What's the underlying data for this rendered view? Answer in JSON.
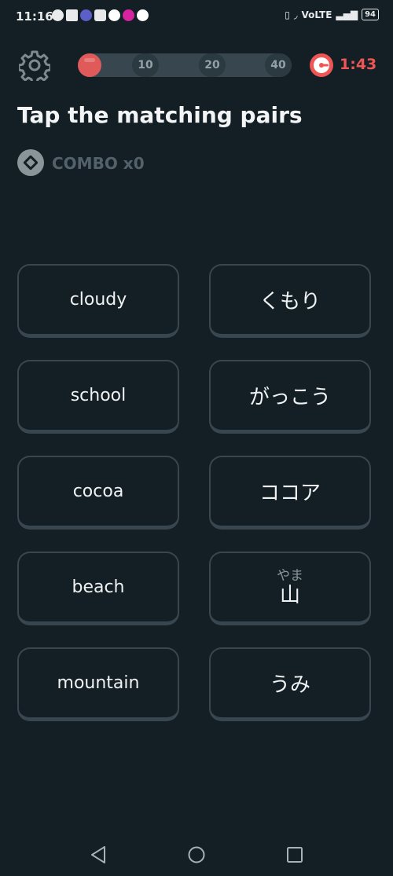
{
  "status": {
    "time": "11:16",
    "network": "VoLTE",
    "battery": "94"
  },
  "header": {
    "progress_fraction": 0.05,
    "milestones": [
      "10",
      "20",
      "40"
    ],
    "timer": "1:43"
  },
  "title": "Tap the matching pairs",
  "combo": "COMBO x0",
  "pairs": {
    "left": [
      "cloudy",
      "school",
      "cocoa",
      "beach",
      "mountain"
    ],
    "right": [
      "くもり",
      "がっこう",
      "ココア",
      "山",
      "うみ"
    ],
    "furigana_yama": "やま"
  },
  "colors": {
    "background": "#131f24",
    "tile_border": "#37464f",
    "accent_red": "#e05a5a",
    "timer_red": "#ee5555"
  },
  "icons": {
    "settings": "gear-icon",
    "timer": "stopwatch-icon",
    "combo": "combo-icon",
    "nav_back": "back-triangle-icon",
    "nav_home": "home-circle-icon",
    "nav_recents": "recents-square-icon"
  }
}
